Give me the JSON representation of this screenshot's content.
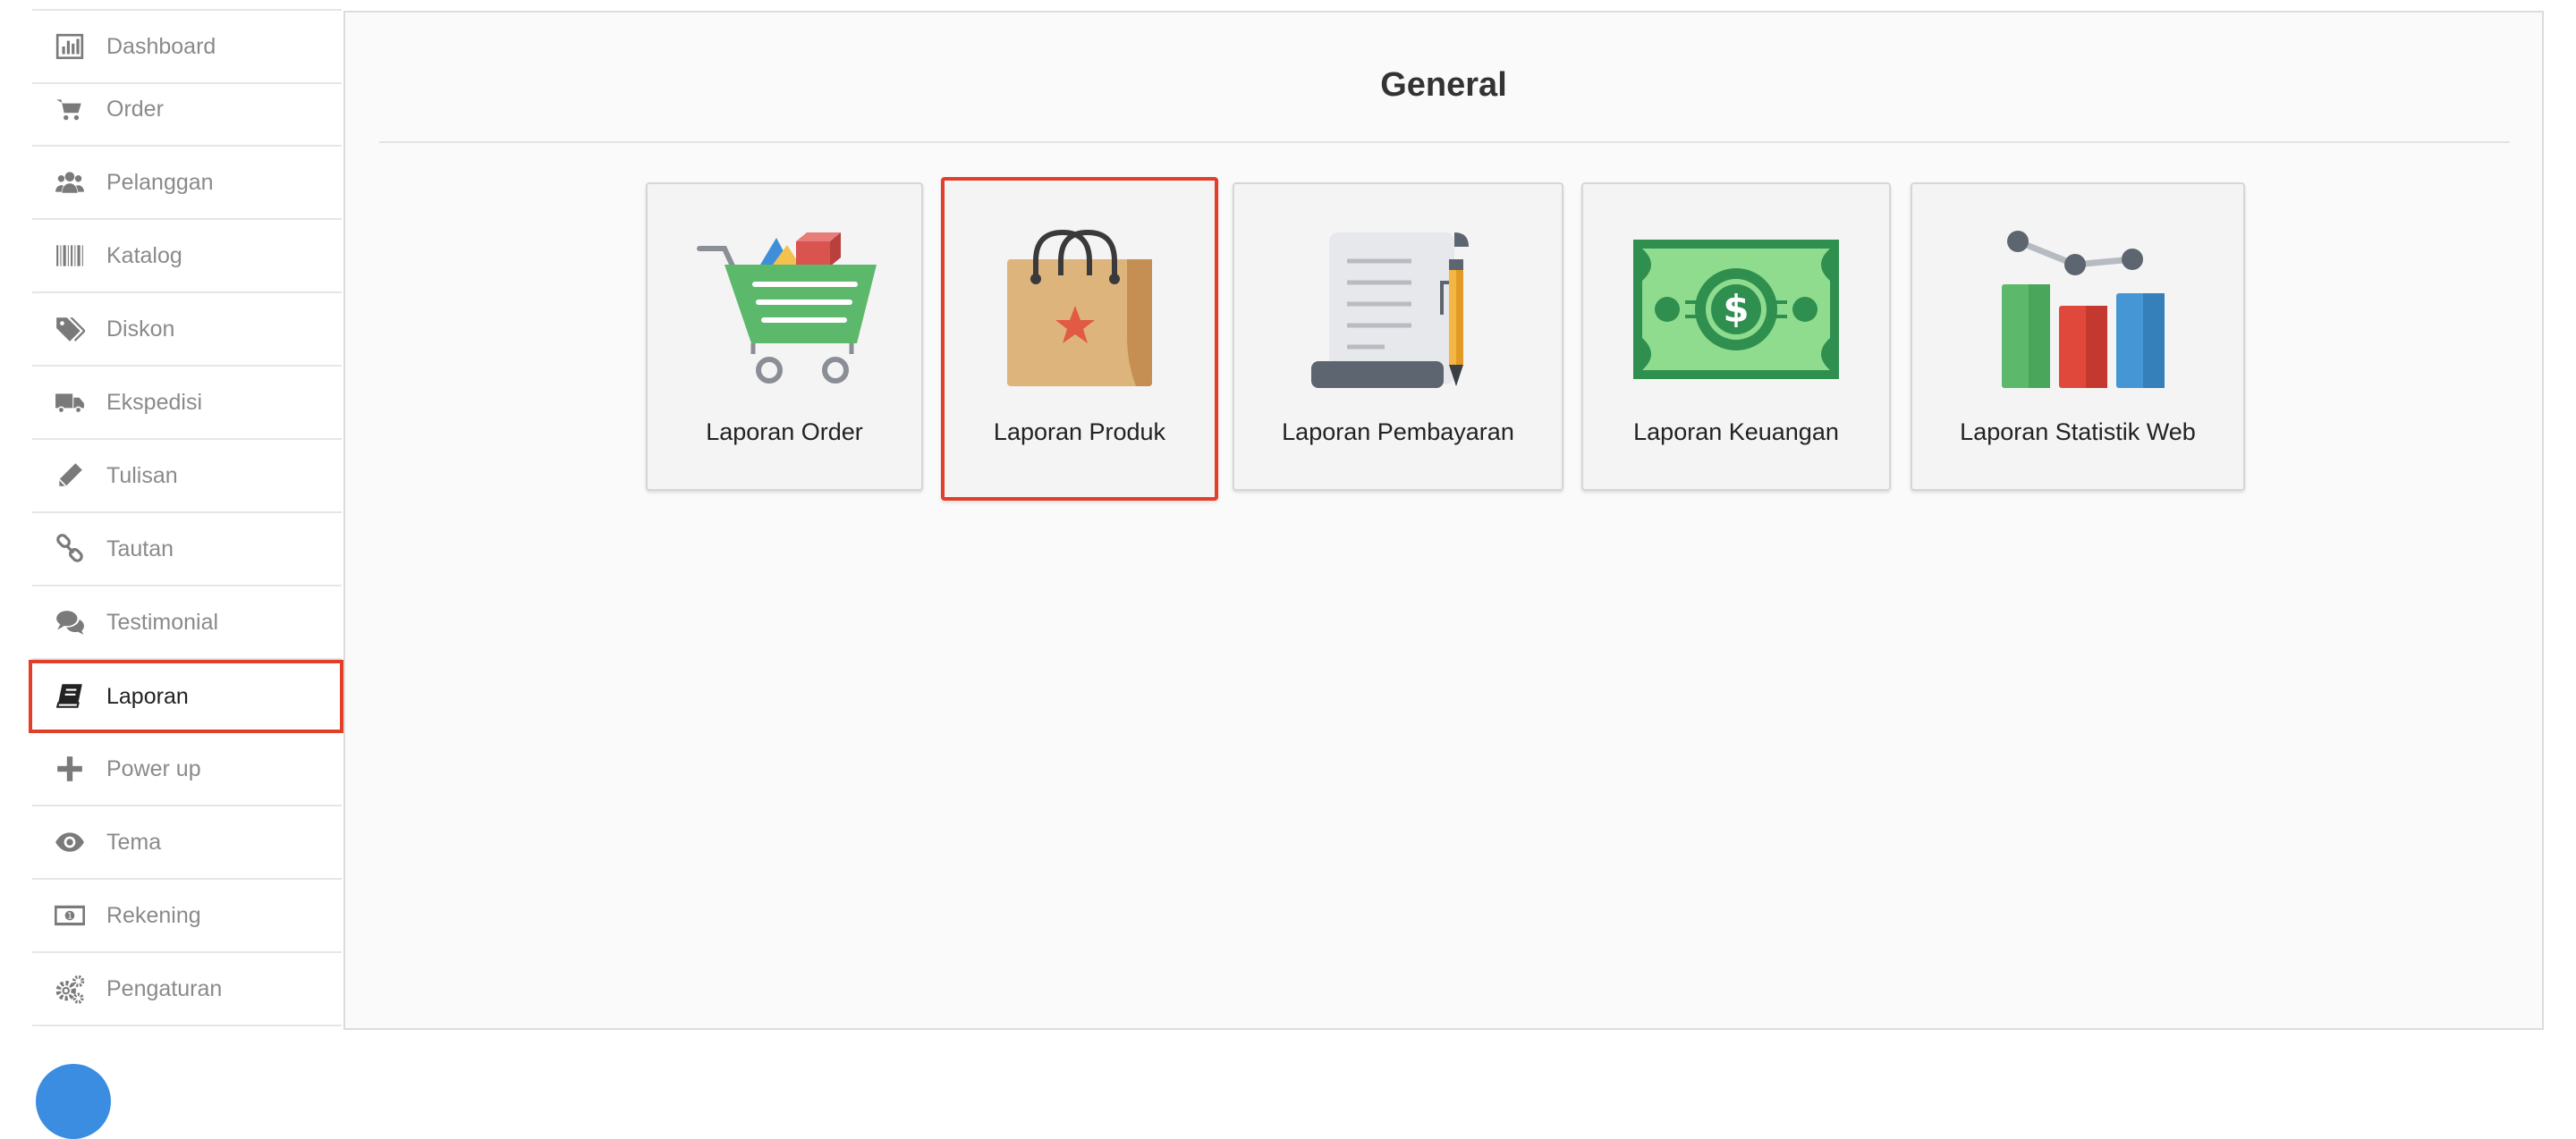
{
  "sidebar": {
    "items": [
      {
        "label": "Dashboard",
        "icon": "bar-chart-icon"
      },
      {
        "label": "Order",
        "icon": "cart-icon"
      },
      {
        "label": "Pelanggan",
        "icon": "users-icon"
      },
      {
        "label": "Katalog",
        "icon": "barcode-icon"
      },
      {
        "label": "Diskon",
        "icon": "tags-icon"
      },
      {
        "label": "Ekspedisi",
        "icon": "truck-icon"
      },
      {
        "label": "Tulisan",
        "icon": "pencil-icon"
      },
      {
        "label": "Tautan",
        "icon": "link-icon"
      },
      {
        "label": "Testimonial",
        "icon": "comments-icon"
      },
      {
        "label": "Laporan",
        "icon": "book-icon",
        "active": true
      },
      {
        "label": "Power up",
        "icon": "plus-icon"
      },
      {
        "label": "Tema",
        "icon": "eye-icon"
      },
      {
        "label": "Rekening",
        "icon": "money-icon"
      },
      {
        "label": "Pengaturan",
        "icon": "gears-icon"
      }
    ]
  },
  "main": {
    "title": "General",
    "cards": [
      {
        "label": "Laporan Order",
        "icon": "shopping-cart-icon"
      },
      {
        "label": "Laporan Produk",
        "icon": "shopping-bag-icon",
        "highlighted": true
      },
      {
        "label": "Laporan Pembayaran",
        "icon": "receipt-pen-icon"
      },
      {
        "label": "Laporan Keuangan",
        "icon": "banknote-icon"
      },
      {
        "label": "Laporan Statistik Web",
        "icon": "statistics-chart-icon"
      }
    ]
  },
  "colors": {
    "highlight_border": "#e23f2a",
    "sidebar_text": "#8a8a8a",
    "sidebar_icon": "#7a7a7a",
    "panel_background": "#fafafa"
  }
}
